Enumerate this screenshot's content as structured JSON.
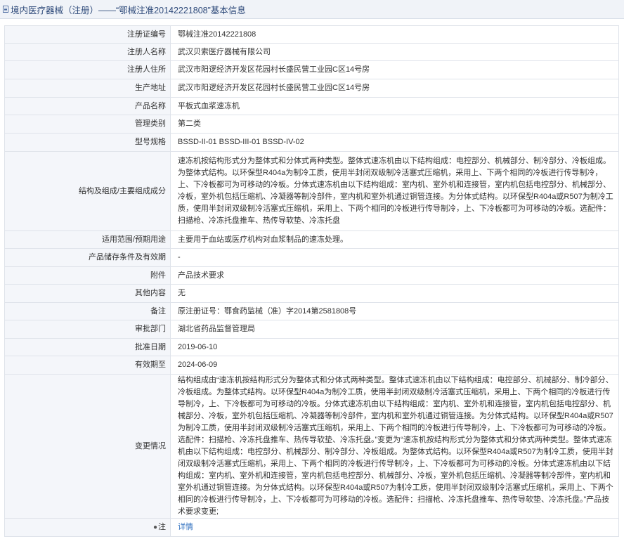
{
  "header": {
    "icon": "document-icon",
    "title": "境内医疗器械（注册）——“鄂械注准20142221808”基本信息"
  },
  "rows": [
    {
      "label": "注册证编号",
      "value": "鄂械注准20142221808"
    },
    {
      "label": "注册人名称",
      "value": "武汉贝索医疗器械有限公司"
    },
    {
      "label": "注册人住所",
      "value": "武汉市阳逻经济开发区花园村长盛民营工业园C区14号房"
    },
    {
      "label": "生产地址",
      "value": "武汉市阳逻经济开发区花园村长盛民营工业园C区14号房"
    },
    {
      "label": "产品名称",
      "value": "平板式血浆速冻机"
    },
    {
      "label": "管理类别",
      "value": "第二类"
    },
    {
      "label": "型号规格",
      "value": "BSSD-II-01 BSSD-III-01 BSSD-IV-02"
    },
    {
      "label": "结构及组成/主要组成成分",
      "value": "速冻机按结构形式分为整体式和分体式两种类型。整体式速冻机由以下结构组成：电控部分、机械部分、制冷部分、冷板组成。为整体式结构。以环保型R404a为制冷工质，使用半封闭双级制冷活塞式压缩机，采用上、下两个相同的冷板进行传导制冷，上、下冷板都可为可移动的冷板。分体式速冻机由以下结构组成：室内机、室外机和连接管，室内机包括电控部分、机械部分、冷板，室外机包括压缩机、冷凝器等制冷部件，室内机和室外机通过铜管连接。为分体式结构。以环保型R404a或R507为制冷工质，使用半封闭双级制冷活塞式压缩机，采用上、下两个相同的冷板进行传导制冷，上、下冷板都可为可移动的冷板。选配件：扫描枪、冷冻托盘推车、热传导软垫、冷冻托盘"
    },
    {
      "label": "适用范围/预期用途",
      "value": "主要用于血站或医疗机构对血浆制品的速冻处理。"
    },
    {
      "label": "产品储存条件及有效期",
      "value": "-"
    },
    {
      "label": "附件",
      "value": "产品技术要求"
    },
    {
      "label": "其他内容",
      "value": "无"
    },
    {
      "label": "备注",
      "value": "原注册证号：鄂食药监械（准）字2014第2581808号"
    },
    {
      "label": "审批部门",
      "value": "湖北省药品监督管理局"
    },
    {
      "label": "批准日期",
      "value": "2019-06-10"
    },
    {
      "label": "有效期至",
      "value": "2024-06-09"
    },
    {
      "label": "变更情况",
      "value": "结构组成由“速冻机按结构形式分为整体式和分体式两种类型。整体式速冻机由以下结构组成：电控部分、机械部分、制冷部分、冷板组成。为整体式结构。以环保型R404a为制冷工质，使用半封闭双级制冷活塞式压缩机，采用上、下两个相同的冷板进行传导制冷，上、下冷板都可为可移动的冷板。分体式速冻机由以下结构组成：室内机、室外机和连接管，室内机包括电控部分、机械部分、冷板，室外机包括压缩机、冷凝器等制冷部件，室内机和室外机通过铜管连接。为分体式结构。以环保型R404a或R507为制冷工质，使用半封闭双级制冷活塞式压缩机，采用上、下两个相同的冷板进行传导制冷，上、下冷板都可为可移动的冷板。选配件：扫描枪、冷冻托盘推车、热传导软垫、冷冻托盘。”变更为“速冻机按结构形式分为整体式和分体式两种类型。整体式速冻机由以下结构组成：电控部分、机械部分、制冷部分、冷板组成。为整体式结构。以环保型R404a或R507为制冷工质，使用半封闭双级制冷活塞式压缩机，采用上、下两个相同的冷板进行传导制冷，上、下冷板都可为可移动的冷板。分体式速冻机由以下结构组成：室内机、室外机和连接管，室内机包括电控部分、机械部分、冷板，室外机包括压缩机、冷凝器等制冷部件，室内机和室外机通过铜管连接。为分体式结构。以环保型R404a或R507为制冷工质，使用半封闭双级制冷活塞式压缩机，采用上、下两个相同的冷板进行传导制冷，上、下冷板都可为可移动的冷板。选配件：扫描枪、冷冻托盘推车、热传导软垫、冷冻托盘。”产品技术要求变更;"
    }
  ],
  "note": {
    "icon": "pin-icon",
    "label": "注",
    "link_text": "详情",
    "link_color": "#2f6fbf"
  }
}
